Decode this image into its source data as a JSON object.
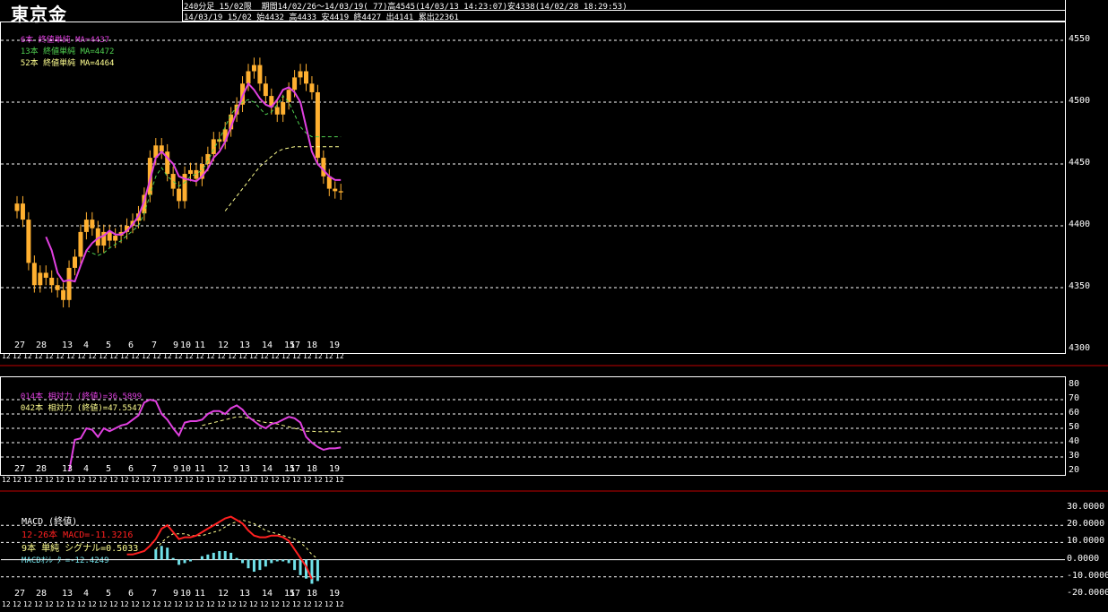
{
  "header": {
    "title": "東京金",
    "line1": "240分足 15/02限  期間14/02/26～14/03/19( 77)高4545(14/03/13 14:23:07)安4338(14/02/28 18:29:53)",
    "line2": "14/03/19 15/02 始4432 高4433 安4419 終4427 出4141 累出22361"
  },
  "main_legend": {
    "ma1": "6本 終値単純 MA=4437",
    "ma2": "13本 終値単純 MA=4472",
    "ma3": "52本 終値単純 MA=4464"
  },
  "rsi_legend": {
    "r1": "014本 相対力 (終値)=36.5899",
    "r2": "042本 相対力 (終値)=47.5547"
  },
  "macd_legend": {
    "name": "MACD (終値)",
    "macd": "12-26本 MACD=-11.3216",
    "signal": "9本 単純 シグナル=0.5033",
    "osc": "MACDｵｼﾚｰﾀｰ=-12.4249"
  },
  "colors": {
    "candle": "#ffb030",
    "ma1": "#e040e0",
    "ma2": "#50d050",
    "ma3": "#ffff90",
    "macd": "#ff2020",
    "signal": "#ffff90",
    "osc": "#70e0e8",
    "grid": "#ffffff"
  },
  "dates": [
    "27",
    "28",
    "13",
    "4",
    "5",
    "6",
    "7",
    "9",
    "10",
    "11",
    "12",
    "13",
    "14",
    "15",
    "17",
    "18",
    "19"
  ],
  "main_axis": [
    "4550",
    "4500",
    "4450",
    "4400",
    "4350",
    "4300"
  ],
  "rsi_axis": [
    "80",
    "70",
    "60",
    "50",
    "40",
    "30",
    "20"
  ],
  "macd_axis": [
    "30.0000",
    "20.0000",
    "10.0000",
    "0.0000",
    "-10.0000",
    "-20.0000"
  ],
  "time_label": "12",
  "chart_data": [
    {
      "type": "candlestick",
      "title": "東京金",
      "ylim": [
        4300,
        4560
      ],
      "close": [
        4418,
        4405,
        4370,
        4352,
        4362,
        4358,
        4352,
        4348,
        4340,
        4366,
        4375,
        4395,
        4405,
        4398,
        4384,
        4395,
        4388,
        4392,
        4395,
        4400,
        4404,
        4410,
        4425,
        4455,
        4465,
        4460,
        4442,
        4430,
        4420,
        4442,
        4445,
        4438,
        4450,
        4458,
        4470,
        4468,
        4478,
        4490,
        4498,
        4515,
        4525,
        4530,
        4515,
        4505,
        4496,
        4490,
        4500,
        4510,
        4520,
        4525,
        4515,
        4508,
        4455,
        4440,
        4430,
        4428,
        4427
      ],
      "series": [
        {
          "name": "6本 終値単純",
          "values": [
            null,
            null,
            null,
            null,
            null,
            4391,
            4380,
            4362,
            4355,
            4356,
            4355,
            4368,
            4380,
            4386,
            4390,
            4392,
            4396,
            4393,
            4393,
            4396,
            4401,
            4408,
            4420,
            4437,
            4455,
            4460,
            4455,
            4450,
            4440,
            4438,
            4437,
            4436,
            4440,
            4446,
            4455,
            4460,
            4468,
            4480,
            4492,
            4505,
            4515,
            4510,
            4503,
            4498,
            4496,
            4502,
            4510,
            4512,
            4508,
            4500,
            4480,
            4460,
            4450,
            4445,
            4440,
            4437,
            4437
          ]
        },
        {
          "name": "13本 終値単純",
          "values": [
            null,
            null,
            null,
            null,
            null,
            null,
            null,
            null,
            null,
            null,
            null,
            null,
            4380,
            4378,
            4376,
            4378,
            4382,
            4385,
            4388,
            4392,
            4396,
            4400,
            4410,
            4425,
            4440,
            4447,
            4440,
            4436,
            4432,
            4435,
            4440,
            4442,
            4445,
            4452,
            4462,
            4470,
            4480,
            4490,
            4496,
            4500,
            4502,
            4500,
            4495,
            4490,
            4492,
            4498,
            4505,
            4500,
            4490,
            4480,
            4475,
            4472,
            4472,
            4472,
            4472,
            4472,
            4472
          ]
        },
        {
          "name": "52本 終値単純",
          "values": [
            null,
            null,
            null,
            null,
            null,
            null,
            null,
            null,
            null,
            null,
            null,
            null,
            null,
            null,
            null,
            null,
            null,
            null,
            null,
            null,
            null,
            null,
            null,
            null,
            null,
            null,
            null,
            null,
            null,
            null,
            null,
            null,
            null,
            null,
            null,
            null,
            4412,
            4418,
            4424,
            4430,
            4436,
            4442,
            4448,
            4452,
            4456,
            4460,
            4462,
            4463,
            4464,
            4464,
            4464,
            4464,
            4464,
            4464,
            4464,
            4464,
            4464
          ]
        }
      ]
    },
    {
      "type": "line",
      "title": "相対力",
      "ylim": [
        20,
        80
      ],
      "series": [
        {
          "name": "014本 相対力 (終値)",
          "values": [
            null,
            null,
            null,
            null,
            null,
            null,
            null,
            null,
            null,
            20,
            42,
            43,
            50,
            49,
            44,
            50,
            48,
            50,
            52,
            53,
            56,
            59,
            68,
            70,
            69,
            60,
            56,
            50,
            45,
            54,
            55,
            55,
            56,
            60,
            62,
            62,
            60,
            64,
            66,
            63,
            58,
            55,
            52,
            50,
            53,
            54,
            56,
            58,
            57,
            54,
            44,
            40,
            37,
            35,
            36,
            36,
            36.6
          ]
        },
        {
          "name": "042本 相対力 (終値)",
          "values": [
            null,
            null,
            null,
            null,
            null,
            null,
            null,
            null,
            null,
            null,
            null,
            null,
            null,
            null,
            null,
            null,
            null,
            null,
            null,
            null,
            null,
            null,
            null,
            null,
            null,
            null,
            null,
            null,
            null,
            null,
            null,
            null,
            52,
            53,
            54,
            55,
            56,
            57,
            58,
            58,
            57,
            56,
            55,
            54,
            54,
            53,
            52,
            51,
            50,
            49,
            48,
            48,
            47.6,
            47.6,
            47.6,
            47.6,
            47.6
          ]
        }
      ]
    },
    {
      "type": "bar+line",
      "title": "MACD (終値)",
      "ylim": [
        -20,
        30
      ],
      "series": [
        {
          "name": "12-26本 MACD",
          "values": [
            null,
            null,
            null,
            null,
            null,
            null,
            null,
            null,
            null,
            null,
            null,
            null,
            null,
            null,
            null,
            null,
            null,
            null,
            null,
            3,
            3,
            4,
            5,
            8,
            12,
            18,
            20,
            16,
            12,
            13,
            13,
            14,
            16,
            18,
            20,
            22,
            24,
            25,
            23,
            21,
            17,
            14,
            13,
            13,
            14,
            14,
            13,
            11,
            6,
            1,
            -4,
            -11.3
          ]
        },
        {
          "name": "9本 単純 シグナル",
          "values": [
            null,
            null,
            null,
            null,
            null,
            null,
            null,
            null,
            null,
            null,
            null,
            null,
            null,
            null,
            null,
            null,
            null,
            null,
            null,
            null,
            null,
            null,
            null,
            null,
            6,
            10,
            13,
            15,
            15,
            15,
            14,
            14,
            14,
            15,
            16,
            17,
            19,
            21,
            22,
            23,
            22,
            21,
            19,
            17,
            16,
            15,
            14,
            13,
            12,
            10,
            7,
            3,
            0.5
          ]
        },
        {
          "name": "MACDｵｼﾚｰﾀｰ",
          "values": [
            null,
            null,
            null,
            null,
            null,
            null,
            null,
            null,
            null,
            null,
            null,
            null,
            null,
            null,
            null,
            null,
            null,
            null,
            null,
            null,
            null,
            null,
            null,
            null,
            6,
            8,
            7,
            1,
            -3,
            -2,
            -1,
            0,
            2,
            3,
            4,
            5,
            5,
            4,
            1,
            -2,
            -5,
            -7,
            -6,
            -4,
            -2,
            -1,
            -1,
            -2,
            -6,
            -9,
            -11,
            -14,
            -12.4
          ]
        }
      ]
    }
  ]
}
